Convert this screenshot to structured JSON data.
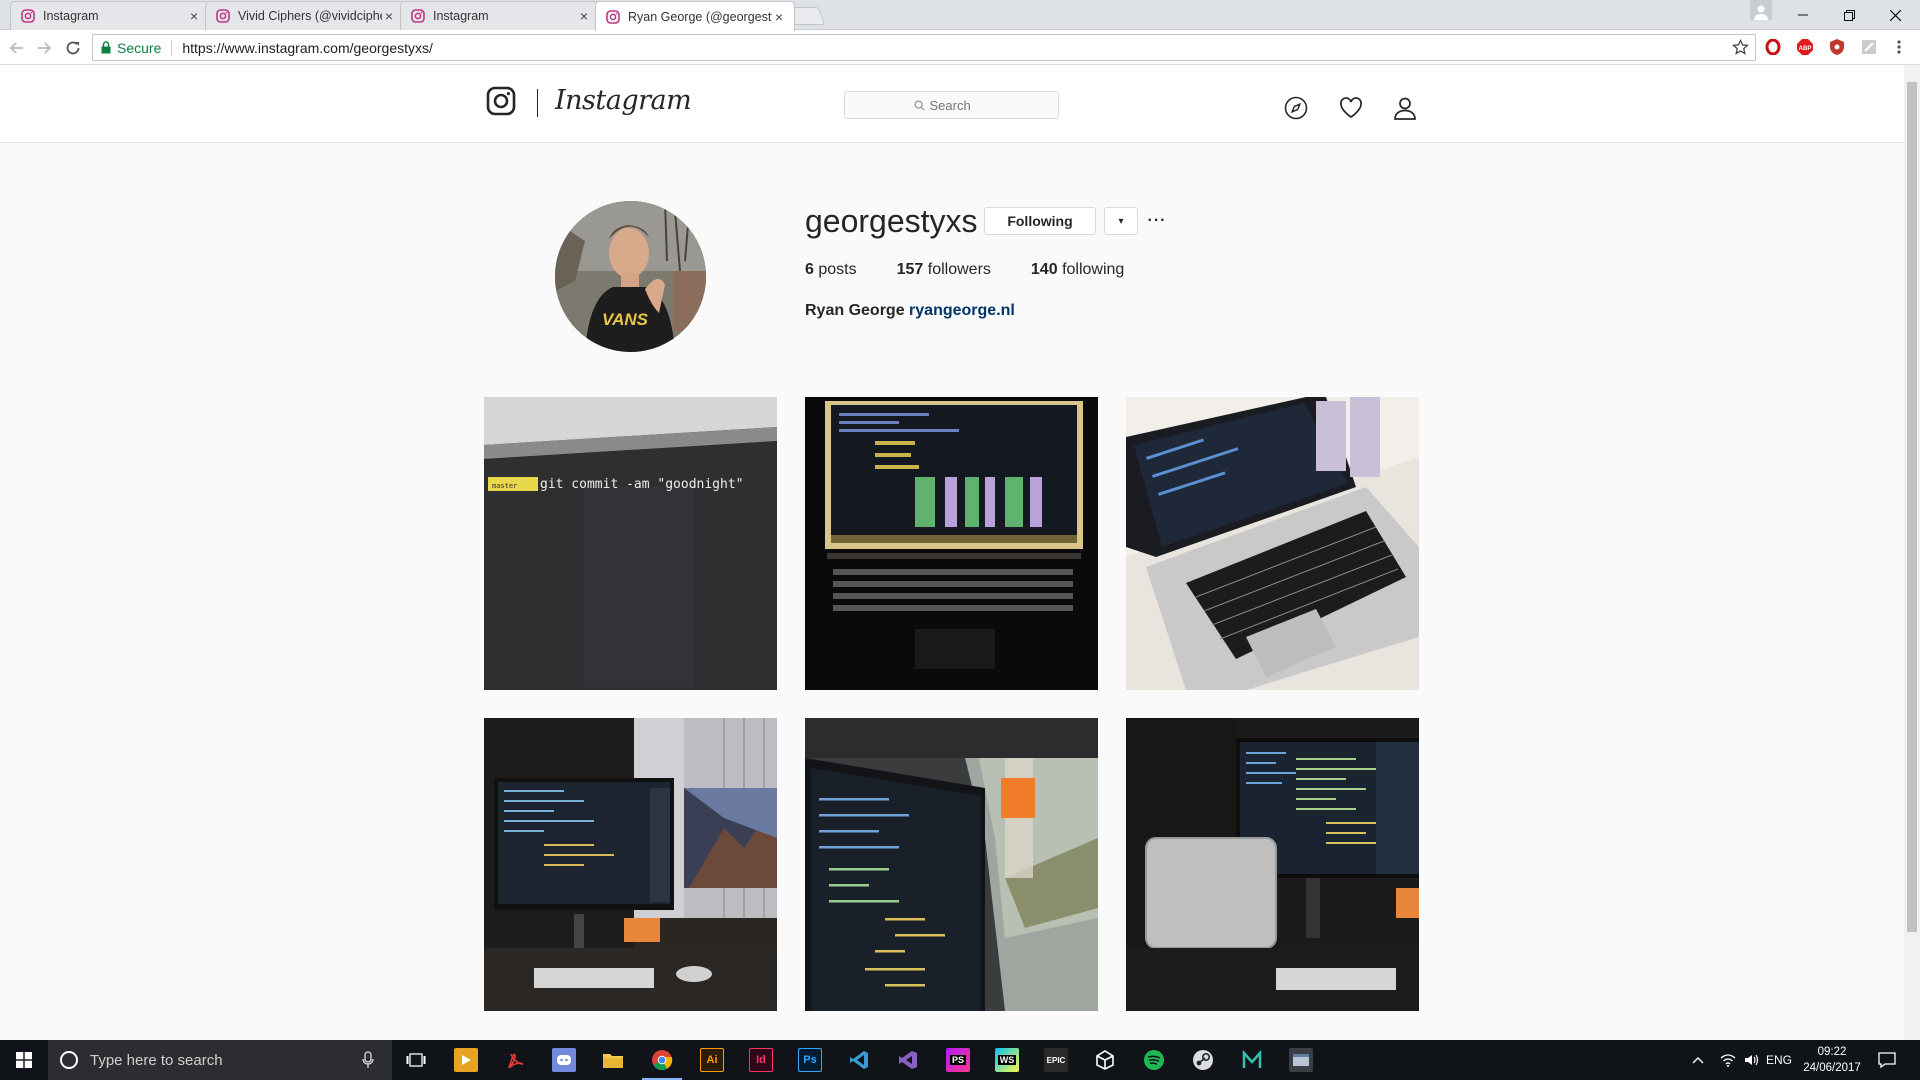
{
  "browser": {
    "tabs": [
      {
        "title": "Instagram",
        "close": "×"
      },
      {
        "title": "Vivid Ciphers (@vividciphers)",
        "close": "×"
      },
      {
        "title": "Instagram",
        "close": "×"
      },
      {
        "title": "Ryan George (@georgestyxs)",
        "close": "×"
      }
    ],
    "active_tab": 3,
    "security_label": "Secure",
    "url": "https://www.instagram.com/georgestyxs/"
  },
  "header": {
    "wordmark": "Instagram",
    "search_placeholder": "Search"
  },
  "profile": {
    "username": "georgestyxs",
    "follow_button": "Following",
    "dropdown_glyph": "▾",
    "more_glyph": "···",
    "posts_count": "6",
    "posts_label": "posts",
    "followers_count": "157",
    "followers_label": "followers",
    "following_count": "140",
    "following_label": "following",
    "full_name": "Ryan George",
    "website": "ryangeorge.nl",
    "avatar_shirt_text": "VANS"
  },
  "posts": [
    {
      "overlay_text": "git commit -am \"goodnight\"",
      "branch_label": "master"
    },
    {},
    {},
    {},
    {},
    {}
  ],
  "taskbar": {
    "search_placeholder": "Type here to search",
    "apps": [
      "explorer-view",
      "media",
      "acrobat",
      "discord",
      "files",
      "chrome",
      "Ai",
      "Id",
      "Ps",
      "vscode",
      "visual-studio",
      "PS",
      "WS",
      "EPIC",
      "unity",
      "spotify",
      "steam",
      "maya",
      "app"
    ],
    "ai_label": "Ai",
    "id_label": "Id",
    "ps_label": "Ps",
    "phpstorm_label": "PS",
    "webstorm_label": "WS",
    "epic_label": "EPIC",
    "language": "ENG",
    "time": "09:22",
    "date": "24/06/2017"
  }
}
